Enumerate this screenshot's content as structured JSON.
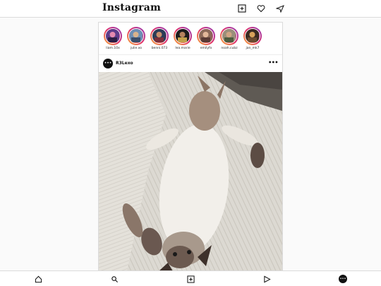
{
  "app": {
    "title": "Instagram"
  },
  "header": {
    "icons": [
      "new-post-icon",
      "heart-icon",
      "direct-message-icon"
    ]
  },
  "stories": [
    {
      "username": "liam.10x",
      "ring_color": "#e1306c"
    },
    {
      "username": "julie.xo",
      "ring_color": "#e1306c"
    },
    {
      "username": "benni.073",
      "ring_color": "#e1306c"
    },
    {
      "username": "lea.marie",
      "ring_color": "#e1306c"
    },
    {
      "username": "emilyfx",
      "ring_color": "#e1306c"
    },
    {
      "username": "noah.cubz",
      "ring_color": "#e1306c"
    },
    {
      "username": "jan_mk7",
      "ring_color": "#e1306c"
    }
  ],
  "post": {
    "username": "R3Lexo",
    "avatar_glyph": "•••",
    "more_label": "•••"
  },
  "bottom_nav": {
    "icons": [
      "home-icon",
      "search-icon",
      "new-post-icon",
      "reels-icon",
      "profile-avatar"
    ],
    "avatar_glyph": "•••"
  },
  "colors": {
    "accent_ring": "#e1306c",
    "border": "#dbdbdb",
    "background": "#fafafa"
  }
}
